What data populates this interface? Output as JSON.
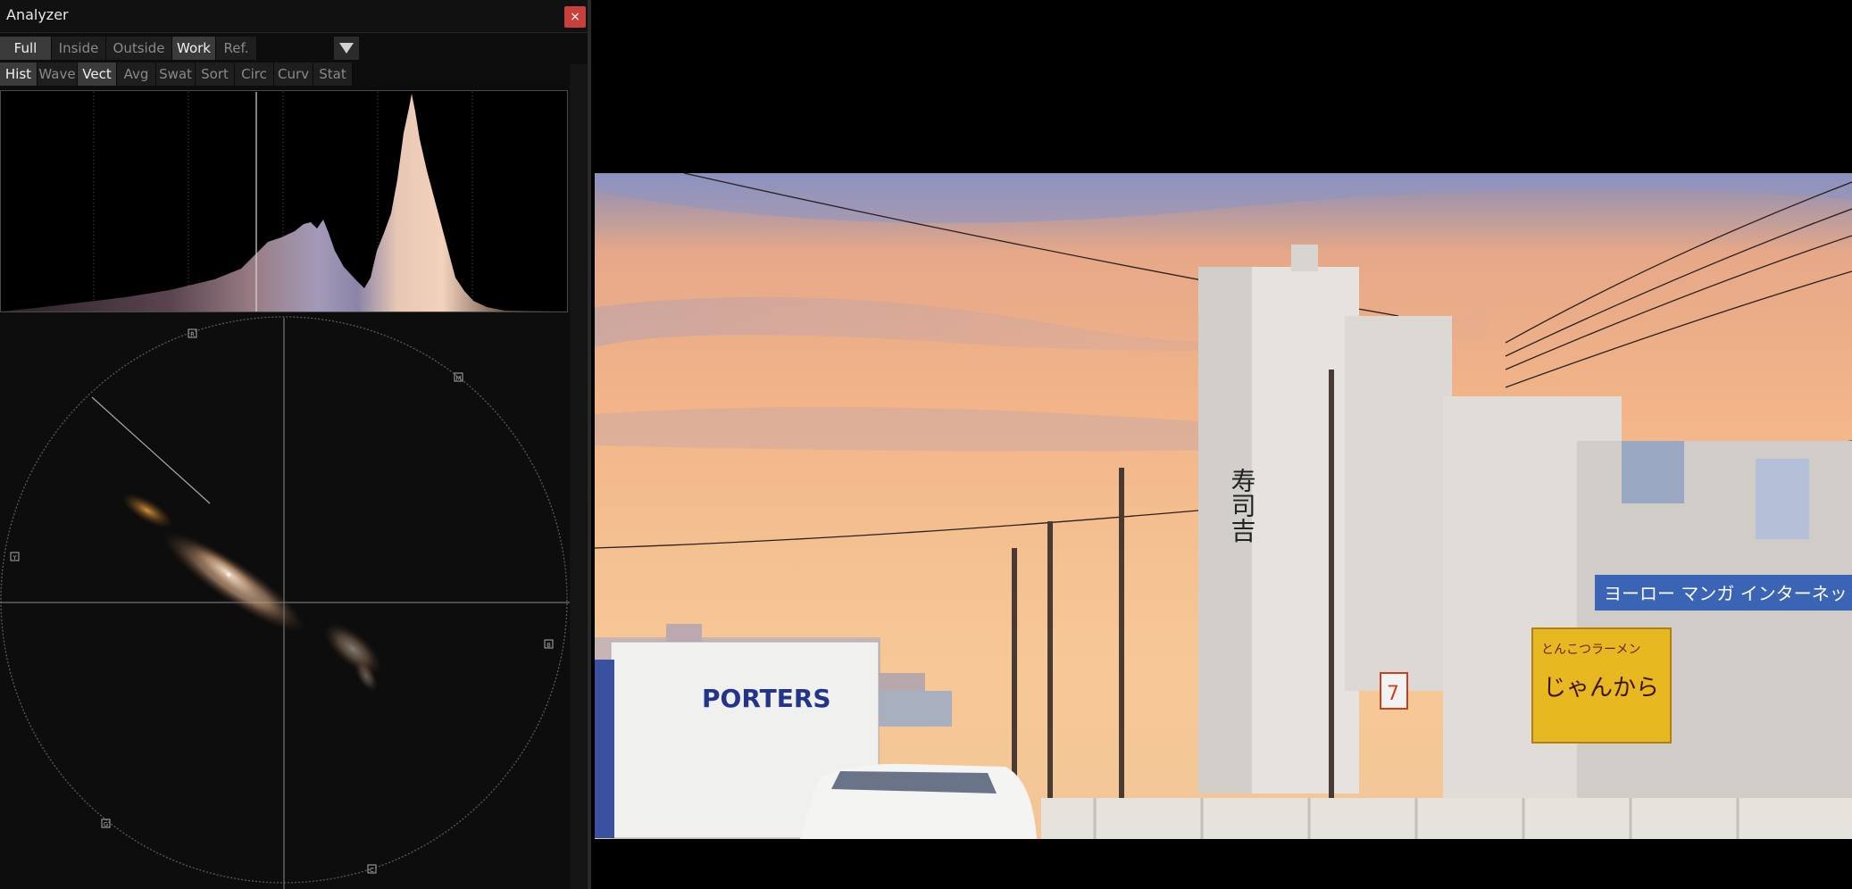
{
  "window": {
    "title": "Analyzer",
    "close_label": "×"
  },
  "toolbar_row1": [
    {
      "label": "Full",
      "active": true
    },
    {
      "label": "Inside",
      "active": false
    },
    {
      "label": "Outside",
      "active": false
    },
    {
      "label": "Work",
      "active": true
    },
    {
      "label": "Ref.",
      "active": false
    }
  ],
  "toolbar_row2": [
    {
      "label": "Hist",
      "active": true
    },
    {
      "label": "Wave",
      "active": false
    },
    {
      "label": "Vect",
      "active": true
    },
    {
      "label": "Avg",
      "active": false
    },
    {
      "label": "Swat",
      "active": false
    },
    {
      "label": "Sort",
      "active": false
    },
    {
      "label": "Circ",
      "active": false
    },
    {
      "label": "Curv",
      "active": false
    },
    {
      "label": "Stat",
      "active": false
    }
  ],
  "vectorscope": {
    "targets": {
      "r": "R",
      "mg": "M",
      "b": "B",
      "cy": "C",
      "g": "G",
      "yl": "Y"
    }
  },
  "viewer": {
    "sign_truck": "PORTERS",
    "sign_ramen_top": "とんこつラーメン",
    "sign_ramen": "じゃんから",
    "sign_banner": "ヨーロー マンガ インターネット",
    "sign_building": "寿司吉",
    "sign_store": "7"
  },
  "colors": {
    "accent_close": "#c8403c",
    "panel_bg": "#0d0d0d",
    "button_active": "#3b3b3b",
    "button_idle": "#1e1e1e"
  }
}
